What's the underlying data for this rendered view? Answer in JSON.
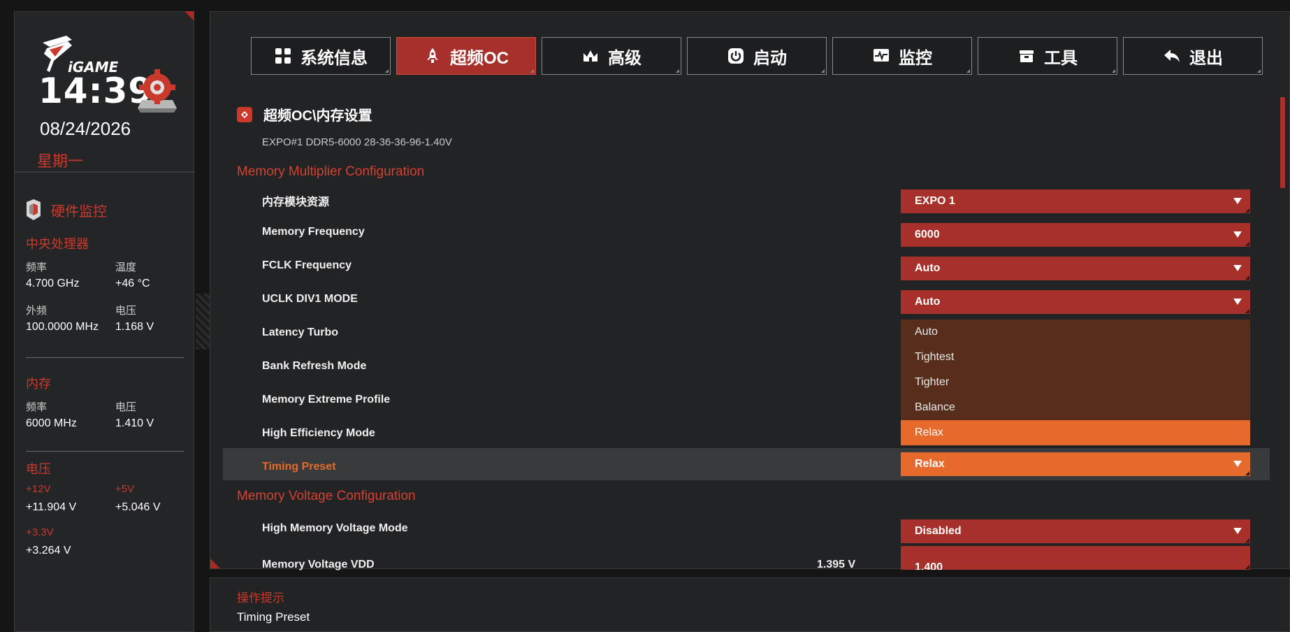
{
  "sidebar": {
    "clock": "14:39",
    "date": "08/24/2026",
    "weekday": "星期一",
    "hw_title": "硬件监控",
    "cpu": {
      "title": "中央处理器",
      "freq_label": "频率",
      "freq_value": "4.700 GHz",
      "temp_label": "温度",
      "temp_value": "+46 °C",
      "bclk_label": "外频",
      "bclk_value": "100.0000 MHz",
      "volt_label": "电压",
      "volt_value": "1.168 V"
    },
    "memory": {
      "title": "内存",
      "freq_label": "频率",
      "freq_value": "6000 MHz",
      "volt_label": "电压",
      "volt_value": "1.410 V"
    },
    "voltage": {
      "title": "电压",
      "v12_label": "+12V",
      "v12_value": "+11.904 V",
      "v5_label": "+5V",
      "v5_value": "+5.046 V",
      "v33_label": "+3.3V",
      "v33_value": "+3.264 V"
    }
  },
  "tabs": [
    {
      "label": "系统信息",
      "icon": "grid-icon"
    },
    {
      "label": "超频OC",
      "icon": "rocket-icon"
    },
    {
      "label": "高级",
      "icon": "crown-icon"
    },
    {
      "label": "启动",
      "icon": "power-icon"
    },
    {
      "label": "监控",
      "icon": "monitor-icon"
    },
    {
      "label": "工具",
      "icon": "toolbox-icon"
    },
    {
      "label": "退出",
      "icon": "back-arrow-icon"
    }
  ],
  "breadcrumb": "超频OC\\内存设置",
  "profile_line": "EXPO#1 DDR5-6000 28-36-36-96-1.40V",
  "groups": {
    "multiplier": "Memory Multiplier Configuration",
    "voltage": "Memory Voltage Configuration"
  },
  "rows": {
    "module_source": {
      "label": "内存模块资源",
      "value": "EXPO 1"
    },
    "memory_frequency": {
      "label": "Memory Frequency",
      "value": "6000"
    },
    "fclk_frequency": {
      "label": "FCLK Frequency",
      "value": "Auto"
    },
    "uclk_div1_mode": {
      "label": "UCLK DIV1 MODE",
      "value": "Auto"
    },
    "latency_turbo": {
      "label": "Latency Turbo"
    },
    "bank_refresh_mode": {
      "label": "Bank Refresh Mode"
    },
    "memory_extreme_profile": {
      "label": "Memory Extreme Profile"
    },
    "high_efficiency_mode": {
      "label": "High Efficiency Mode"
    },
    "timing_preset": {
      "label": "Timing Preset",
      "value": "Relax"
    },
    "high_memory_voltage_mode": {
      "label": "High Memory Voltage Mode",
      "value": "Disabled"
    },
    "memory_voltage_vdd": {
      "label": "Memory Voltage VDD",
      "current": "1.395 V",
      "value": "1.400"
    }
  },
  "dropdown_options": [
    "Auto",
    "Tightest",
    "Tighter",
    "Balance",
    "Relax"
  ],
  "hint": {
    "title": "操作提示",
    "text": "Timing Preset"
  },
  "colors": {
    "accent_red": "#a8302a",
    "accent_orange": "#e66a2c",
    "menu_bg": "#572d1c",
    "panel_bg": "#222325"
  }
}
